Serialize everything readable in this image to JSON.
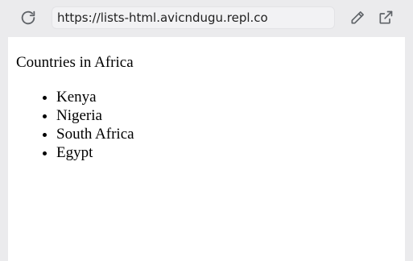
{
  "browser": {
    "url": "https://lists-html.avicndugu.repl.co",
    "icons": {
      "reload": "reload-icon",
      "edit": "pencil-icon",
      "open_external": "open-in-new-tab-icon"
    }
  },
  "page": {
    "heading": "Countries in Africa",
    "countries": [
      "Kenya",
      "Nigeria",
      "South Africa",
      "Egypt"
    ]
  },
  "colors": {
    "toolbar_bg": "#ebebed",
    "page_bg": "#ffffff",
    "icon": "#5f6368"
  }
}
